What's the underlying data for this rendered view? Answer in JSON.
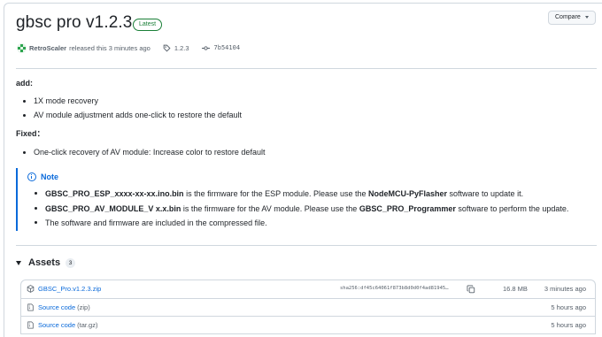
{
  "release": {
    "title": "gbsc pro v1.2.3",
    "badge": "Latest",
    "compare_label": "Compare",
    "author": "RetroScaler",
    "released_text": "released this 3 minutes ago",
    "tag": "1.2.3",
    "commit": "7b54104"
  },
  "notes": {
    "add_heading": "add:",
    "add_items": [
      "1X mode recovery",
      "AV module adjustment adds one-click to restore the default"
    ],
    "fixed_heading": "Fixed：",
    "fixed_items": [
      "One-click recovery of AV module: Increase color to restore default"
    ],
    "note_title": "Note",
    "note_items": [
      {
        "bold": "GBSC_PRO_ESP_xxxx-xx-xx.ino.bin",
        "text1": " is the firmware for the ESP module. Please use the ",
        "bold2": "NodeMCU-PyFlasher",
        "text2": " software to update it."
      },
      {
        "bold": "GBSC_PRO_AV_MODULE_V x.x.bin",
        "text1": " is the firmware for the AV module. Please use the ",
        "bold2": "GBSC_PRO_Programmer",
        "text2": " software to perform the update."
      },
      {
        "bold": "",
        "text1": "The software and firmware are included in the compressed file.",
        "bold2": "",
        "text2": ""
      }
    ]
  },
  "assets": {
    "heading": "Assets",
    "count": "3",
    "items": [
      {
        "name": "GBSC_Pro.v1.2.3.zip",
        "paren": "",
        "sha": "sha256:df45c64061f873b8d0d0f4ad81945…",
        "size": "16.8 MB",
        "time": "3 minutes ago"
      },
      {
        "name": "Source code",
        "paren": "(zip)",
        "sha": "",
        "size": "",
        "time": "5 hours ago"
      },
      {
        "name": "Source code",
        "paren": "(tar.gz)",
        "sha": "",
        "size": "",
        "time": "5 hours ago"
      }
    ]
  },
  "colors": {
    "accent": "#0969da",
    "success": "#1a7f37",
    "muted": "#57606a",
    "border": "#d0d7de"
  }
}
